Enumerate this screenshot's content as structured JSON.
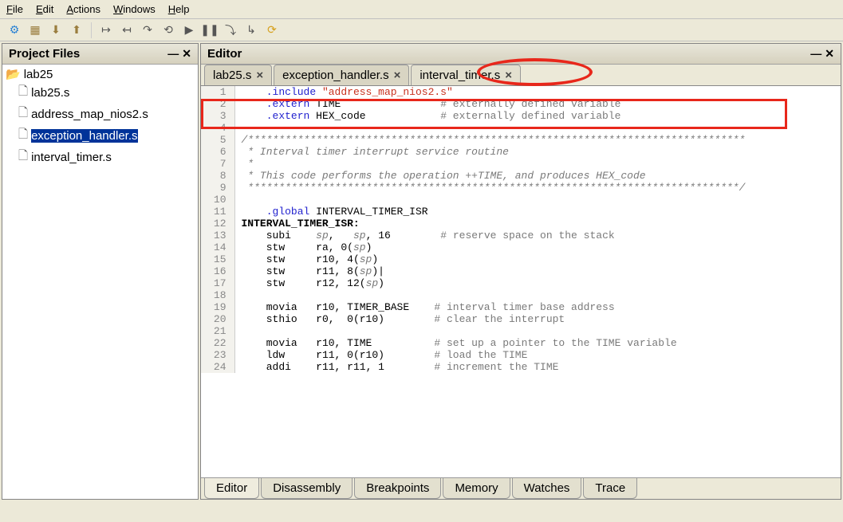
{
  "menu": {
    "file": "File",
    "edit": "Edit",
    "actions": "Actions",
    "windows": "Windows",
    "help": "Help"
  },
  "panels": {
    "project": "Project Files",
    "editor": "Editor"
  },
  "tree": {
    "root": "lab25",
    "files": [
      "lab25.s",
      "address_map_nios2.s",
      "exception_handler.s",
      "interval_timer.s"
    ]
  },
  "editor_tabs": [
    {
      "label": "lab25.s"
    },
    {
      "label": "exception_handler.s"
    },
    {
      "label": "interval_timer.s"
    }
  ],
  "bottom_tabs": [
    "Editor",
    "Disassembly",
    "Breakpoints",
    "Memory",
    "Watches",
    "Trace"
  ],
  "code": {
    "l1_dir": ".include",
    "l1_str": "\"address_map_nios2.s\"",
    "l2_dir": ".extern",
    "l2_sym": "TIME",
    "l2_cm": "# externally defined variable",
    "l3_dir": ".extern",
    "l3_sym": "HEX_code",
    "l3_cm": "# externally defined variable",
    "l5": "/********************************************************************************",
    "l6": " * Interval timer interrupt service routine",
    "l7": " *",
    "l8": " * This code performs the operation ++TIME, and produces HEX_code",
    "l9": " *******************************************************************************/",
    "l11_dir": ".global",
    "l11_sym": "INTERVAL_TIMER_ISR",
    "l12": "INTERVAL_TIMER_ISR:",
    "l13_op": "subi",
    "l13_a": "sp",
    "l13_b": "sp",
    "l13_c": "16",
    "l13_cm": "# reserve space on the stack",
    "l14_op": "stw",
    "l14_a": "ra, 0(",
    "l14_b": "sp",
    "l14_c": ")",
    "l15_op": "stw",
    "l15_a": "r10, 4(",
    "l15_b": "sp",
    "l15_c": ")",
    "l16_op": "stw",
    "l16_a": "r11, 8(",
    "l16_b": "sp",
    "l16_c": ")|",
    "l17_op": "stw",
    "l17_a": "r12, 12(",
    "l17_b": "sp",
    "l17_c": ")",
    "l19_op": "movia",
    "l19_a": "r10, TIMER_BASE",
    "l19_cm": "# interval timer base address",
    "l20_op": "sthio",
    "l20_a": "r0,  0(r10)",
    "l20_cm": "# clear the interrupt",
    "l22_op": "movia",
    "l22_a": "r10, TIME",
    "l22_cm": "# set up a pointer to the TIME variable",
    "l23_op": "ldw",
    "l23_a": "r11, 0(r10)",
    "l23_cm": "# load the TIME",
    "l24_op": "addi",
    "l24_a": "r11, r11, 1",
    "l24_cm": "# increment the TIME"
  }
}
